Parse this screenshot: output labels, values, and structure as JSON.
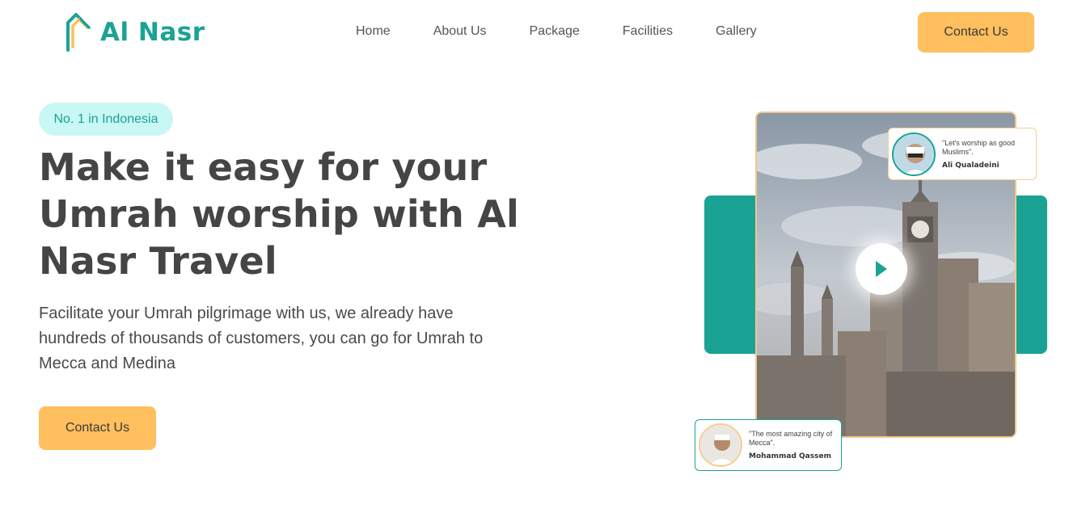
{
  "brand": {
    "name": "Al Nasr",
    "color": "#1aa394",
    "accent": "#ffbf5e"
  },
  "nav": {
    "items": [
      {
        "label": "Home"
      },
      {
        "label": "About Us"
      },
      {
        "label": "Package"
      },
      {
        "label": "Facilities"
      },
      {
        "label": "Gallery"
      }
    ],
    "cta_label": "Contact Us"
  },
  "hero": {
    "badge": "No. 1 in Indonesia",
    "title": "Make it easy for your Umrah worship with Al Nasr Travel",
    "description": "Facilitate your Umrah pilgrimage with us, we already have hundreds of thousands of customers, you can go for Umrah to Mecca and Medina",
    "cta_label": "Contact Us"
  },
  "media": {
    "play_icon": "play-icon",
    "testimonials": [
      {
        "quote": "\"Let's worship as good Muslims\".",
        "name": "Ali Qualadeini"
      },
      {
        "quote": "\"The most amazing city of Mecca\".",
        "name": "Mohammad Qassem"
      }
    ]
  }
}
